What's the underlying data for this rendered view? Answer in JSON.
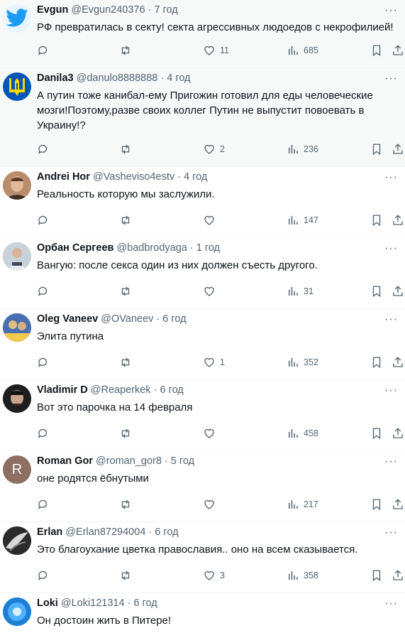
{
  "tweets": [
    {
      "name": "Evgun",
      "handle": "@Evgun240376",
      "sep": "·",
      "time": "7 год",
      "text": "РФ превратилась в секту! секта агрессивных людоедов с некрофилией!",
      "likes": "11",
      "views": "685",
      "avatar_letter": "",
      "avatar_color": "#1d9bf0",
      "highlight": true
    },
    {
      "name": "Danila3",
      "handle": "@danulo8888888",
      "sep": "·",
      "time": "4 год",
      "text": "А путин тоже канибал-ему Пригожин готовил для еды человеческие мозги!Поэтому,разве своих коллег Путин не выпустит повоевать в Украину!?",
      "likes": "2",
      "views": "236",
      "avatar_letter": "",
      "avatar_color": "#0057b7",
      "highlight": true
    },
    {
      "name": "Andrei Hor",
      "handle": "@Vasheviso4estv",
      "sep": "·",
      "time": "4 год",
      "text": "Реальность которую мы заслужили.",
      "likes": "",
      "views": "147",
      "avatar_letter": "",
      "avatar_color": "#8a5a3c",
      "highlight": false
    },
    {
      "name": "Орбан Сергеев",
      "handle": "@badbrodyaga",
      "sep": "·",
      "time": "1 год",
      "text": "Вангую: после секса один из них должен съесть другого.",
      "likes": "",
      "views": "31",
      "avatar_letter": "",
      "avatar_color": "#6c7a86",
      "highlight": false
    },
    {
      "name": "Oleg Vaneev",
      "handle": "@OVaneev",
      "sep": "·",
      "time": "6 год",
      "text": "Элита путина",
      "likes": "1",
      "views": "352",
      "avatar_letter": "",
      "avatar_color": "#3a5a9a",
      "highlight": false
    },
    {
      "name": "Vladimir D",
      "handle": "@Reaperkek",
      "sep": "·",
      "time": "6 год",
      "text": "Вот это парочка на 14 февраля",
      "likes": "",
      "views": "458",
      "avatar_letter": "",
      "avatar_color": "#2a2a2a",
      "highlight": false
    },
    {
      "name": "Roman Gor",
      "handle": "@roman_gor8",
      "sep": "·",
      "time": "5 год",
      "text": "оне родятся ёбнутыми",
      "likes": "",
      "views": "217",
      "avatar_letter": "R",
      "avatar_color": "#8d6e63",
      "highlight": false
    },
    {
      "name": "Erlan",
      "handle": "@Erlan87294004",
      "sep": "·",
      "time": "6 год",
      "text": "Это благоухание цветка православия.. оно на всем сказывается.",
      "likes": "3",
      "views": "358",
      "avatar_letter": "",
      "avatar_color": "#333333",
      "highlight": false
    },
    {
      "name": "Loki",
      "handle": "@Loki121314",
      "sep": "·",
      "time": "6 год",
      "text": "Он достоин жить в Питере!",
      "likes": "",
      "views": "",
      "avatar_letter": "",
      "avatar_color": "#1d9bf0",
      "highlight": false
    }
  ],
  "icons": {
    "reply": "reply-icon",
    "retweet": "retweet-icon",
    "like": "heart-icon",
    "views": "views-icon",
    "bookmark": "bookmark-icon",
    "share": "share-icon",
    "more": "more-icon"
  }
}
